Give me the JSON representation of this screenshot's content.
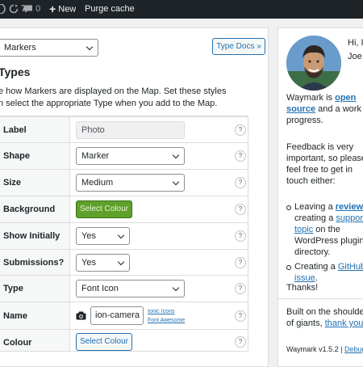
{
  "admin_bar": {
    "updates_count": "7",
    "comments_count": "0",
    "new_label": "New",
    "purge_label": "Purge cache"
  },
  "main": {
    "type_select_value": "Markers",
    "type_docs_button": "Type Docs »",
    "heading": "Types",
    "description_line1": "e how Markers are displayed on the Map. Set these styles",
    "description_line2": "n select the appropriate Type when you add to the Map.",
    "rows": [
      {
        "label": "Label",
        "value": "Photo"
      },
      {
        "label": "Shape",
        "value": "Marker"
      },
      {
        "label": "Size",
        "value": "Medium"
      },
      {
        "label": "Background",
        "value": "Select Colour"
      },
      {
        "label": "Show Initially",
        "value": "Yes"
      },
      {
        "label": "Submissions?",
        "value": "Yes"
      },
      {
        "label": "Type",
        "value": "Font Icon"
      },
      {
        "label": "Name",
        "value": "ion-camera",
        "link1": "Ionic Icons",
        "link2": "Font Awesome"
      },
      {
        "label": "Colour",
        "value": "Select Colour"
      }
    ],
    "help_glyph": "?",
    "background_color": "#5fa02a"
  },
  "sidebar": {
    "greeting1": "Hi, I",
    "greeting2": "Joe",
    "intro_a": "Waymark is ",
    "intro_link": "open source",
    "intro_b": " and a work in progress.",
    "feedback": "Feedback is very important, so please feel free to get in touch either:",
    "bullet1_a": "Leaving a ",
    "bullet1_link1": "review",
    "bullet1_b": ", creating a ",
    "bullet1_link2": "support topic",
    "bullet1_c": " on the WordPress plugin directory.",
    "bullet2_a": "Creating a ",
    "bullet2_link": "GitHub issue",
    "bullet2_b": ".",
    "thanks": "Thanks!",
    "built_a": "Built on the shoulders of giants, ",
    "built_link": "thank you",
    "built_b": "!",
    "version": "Waymark v1.5.2 | ",
    "debug_link": "Debug"
  }
}
